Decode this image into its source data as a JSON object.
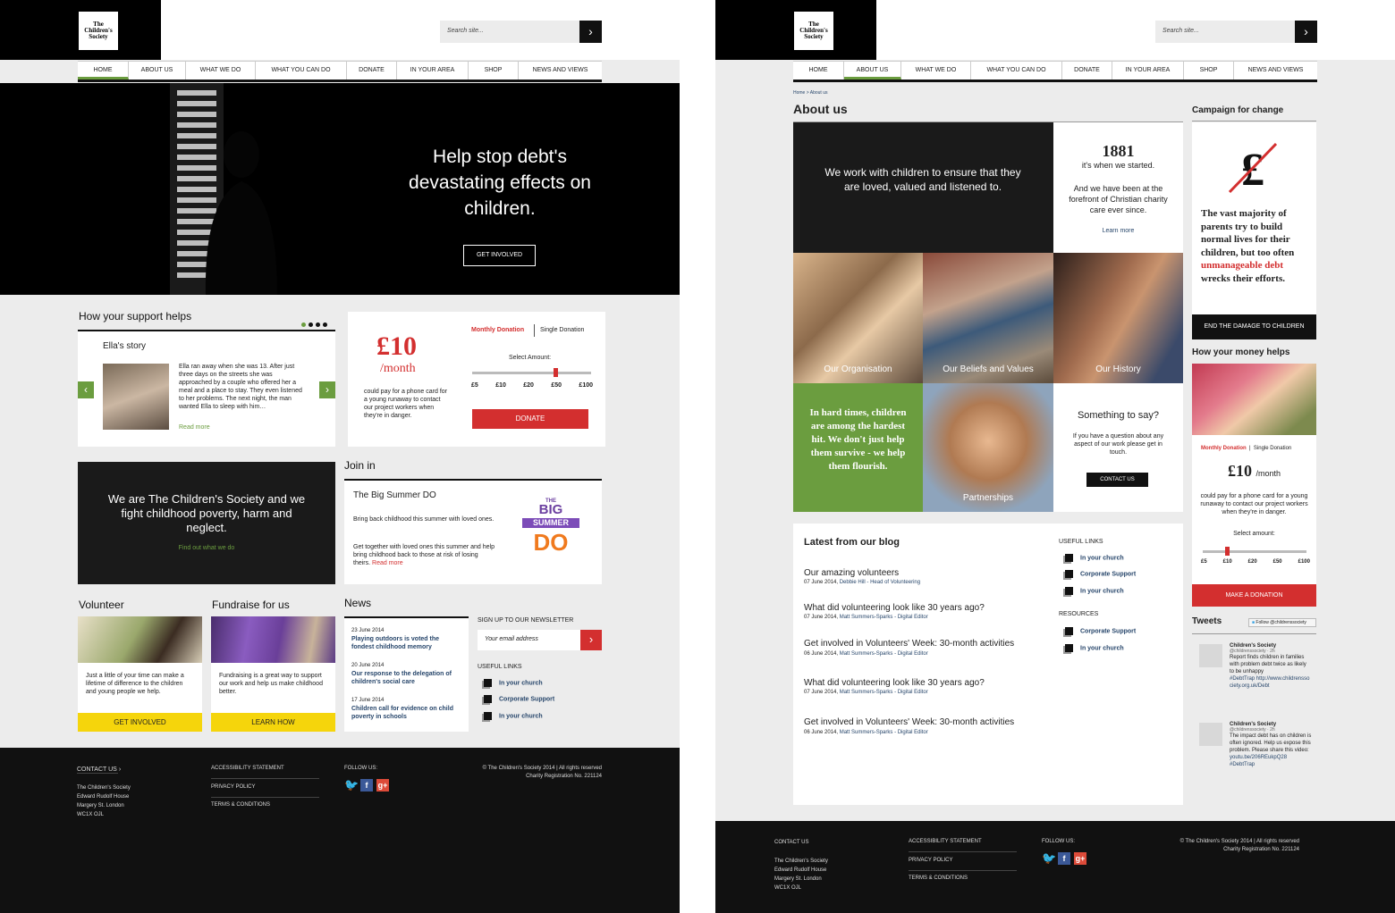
{
  "brand": {
    "logo_text": "The Children's Society",
    "accent_green": "#6b9d3f",
    "accent_red": "#d32f2f",
    "dark": "#111111"
  },
  "header": {
    "search_placeholder": "Search site...",
    "search_icon": "chevron-right-icon"
  },
  "nav": [
    "HOME",
    "ABOUT US",
    "WHAT WE DO",
    "WHAT YOU CAN DO",
    "DONATE",
    "IN YOUR AREA",
    "SHOP",
    "NEWS AND VIEWS"
  ],
  "home": {
    "hero": {
      "headline": "Help stop debt's devastating effects on children.",
      "cta": "GET INVOLVED"
    },
    "support": {
      "title": "How your support helps",
      "story_title": "Ella's story",
      "story_text": "Ella ran away when she was 13. After just three days on the streets she was approached by a couple who offered her a meal and a place to stay. They even listened to her problems. The next night, the man wanted Ella to sleep with him…",
      "read_more": "Read more"
    },
    "donate": {
      "amount": "£10",
      "per": "/month",
      "desc": "could pay for a phone card for a young runaway to contact our project workers when they're in danger.",
      "tab_monthly": "Monthly Donation",
      "tab_single": "Single Donation",
      "select_label": "Select Amount:",
      "amounts": [
        "£5",
        "£10",
        "£20",
        "£50",
        "£100"
      ],
      "button": "DONATE"
    },
    "mission": {
      "text": "We are The Children's Society and we fight childhood poverty, harm and neglect.",
      "link": "Find out what we do"
    },
    "join": {
      "title": "Join in",
      "event": "The Big Summer DO",
      "p1": "Bring back childhood this summer with loved ones.",
      "p2": "Get together with loved ones this summer and help bring childhood back to those at risk of losing theirs.",
      "read_more": "Read more",
      "logo_lines": [
        "THE",
        "BIG",
        "SUMMER",
        "DO"
      ]
    },
    "volunteer": {
      "title": "Volunteer",
      "text": "Just a little of your time can make a lifetime of difference to the children and young people we help.",
      "button": "GET INVOLVED"
    },
    "fundraise": {
      "title": "Fundraise for us",
      "text": "Fundraising is a great way to support our work and help us make childhood better.",
      "button": "LEARN HOW"
    },
    "news": {
      "title": "News",
      "items": [
        {
          "date": "23 June 2014",
          "headline": "Playing outdoors is voted the fondest childhood memory"
        },
        {
          "date": "20 June 2014",
          "headline": "Our response to the delegation of children's social care"
        },
        {
          "date": "17 June 2014",
          "headline": "Children call for evidence on child poverty in schools"
        }
      ]
    },
    "newsletter": {
      "title": "SIGN UP TO OUR NEWSLETTER",
      "placeholder": "Your email address"
    },
    "useful_links": {
      "title": "USEFUL LINKS",
      "items": [
        "In your church",
        "Corporate Support",
        "In your church"
      ]
    }
  },
  "footer": {
    "contact": "CONTACT US",
    "address": [
      "The Children's Society",
      "Edward Rudolf House",
      "Margery St. London",
      "WC1X OJL"
    ],
    "links": [
      "ACCESSIBILITY STATEMENT",
      "PRIVACY POLICY",
      "TERMS & CONDITIONS"
    ],
    "follow": "FOLLOW US:",
    "copyright": "© The Children's Society 2014 | All rights reserved",
    "charity": "Charity Registration No. 221124"
  },
  "about": {
    "breadcrumb": "Home > About us",
    "title": "About us",
    "statement": "We work with children to ensure that they are loved, valued and listened to.",
    "year": "1881",
    "year_caption": "it's when we started.",
    "year_text": "And we have been at the forefront of Christian charity care ever since.",
    "learn_more": "Learn more",
    "tiles": [
      "Our Organisation",
      "Our Beliefs and Values",
      "Our History",
      "Partnerships"
    ],
    "quote": "In hard times, children are among the hardest hit. We don't just help them survive - we help them flourish.",
    "say": {
      "title": "Something to say?",
      "text": "If you have a question about any aspect of our work please get in touch.",
      "button": "CONTACT US"
    },
    "blog": {
      "title": "Latest from our blog",
      "posts": [
        {
          "title": "Our amazing volunteers",
          "date": "07 June 2014,",
          "author": "Debbie Hill - Head of Volunteering"
        },
        {
          "title": "What did volunteering look like 30 years ago?",
          "date": "07 June 2014,",
          "author": "Matt Summers-Sparks - Digital Editor"
        },
        {
          "title": "Get involved in Volunteers' Week: 30-month activities",
          "date": "06 June 2014,",
          "author": "Matt Summers-Sparks - Digital Editor"
        },
        {
          "title": "What did volunteering look like 30 years ago?",
          "date": "07 June 2014,",
          "author": "Matt Summers-Sparks - Digital Editor"
        },
        {
          "title": "Get involved in Volunteers' Week: 30-month activities",
          "date": "06 June 2014,",
          "author": "Matt Summers-Sparks - Digital Editor"
        }
      ],
      "useful_title": "USEFUL LINKS",
      "useful": [
        "In your church",
        "Corporate Support",
        "In your church"
      ],
      "resources_title": "RESOURCES",
      "resources": [
        "Corporate Support",
        "In your church"
      ]
    },
    "campaign": {
      "title": "Campaign for change",
      "text_a": "The vast majority of parents try to build normal lives for their children, but too often ",
      "text_red": "unmanageable debt",
      "text_b": " wrecks their efforts.",
      "button": "END THE DAMAGE TO CHILDREN"
    },
    "money": {
      "title": "How your money helps",
      "tab_monthly": "Monthly Donation",
      "tab_single": "Single Donation",
      "amount": "£10",
      "per": "/month",
      "desc": "could pay for a phone card for a young runaway to contact our project workers when they're in danger.",
      "select_label": "Select amount:",
      "amounts": [
        "£5",
        "£10",
        "£20",
        "£50",
        "£100"
      ],
      "button": "MAKE A DONATION"
    },
    "tweets": {
      "title": "Tweets",
      "follow": "Follow @childrenssociety",
      "items": [
        {
          "name": "Children's Society",
          "handle": "@childrenssociety · 2h",
          "text": "Report finds children in families with problem debt twice as likely to be unhappy",
          "link": "#DebtTrap http://www.childrenssociety.org.uk/Debt"
        },
        {
          "name": "Children's Society",
          "handle": "@childrenssociety · 2h",
          "text": "The impact debt has on children is often ignored. Help us expose this problem. Please share this video:",
          "link": "youtu.be/206REukpQ28 #DebtTrap"
        }
      ]
    }
  }
}
